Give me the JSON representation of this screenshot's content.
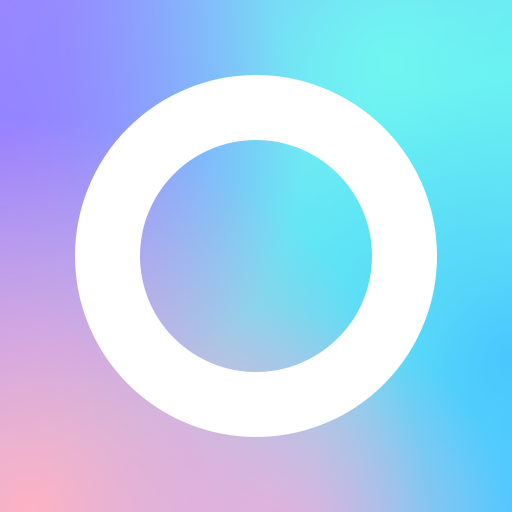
{
  "icon": {
    "ring_icon": "ring-icon",
    "colors": {
      "ring": "#ffffff",
      "violet": "#9680ff",
      "cyan": "#70f8f0",
      "pink": "#ffb2c4",
      "blue": "#46c4ff"
    }
  }
}
